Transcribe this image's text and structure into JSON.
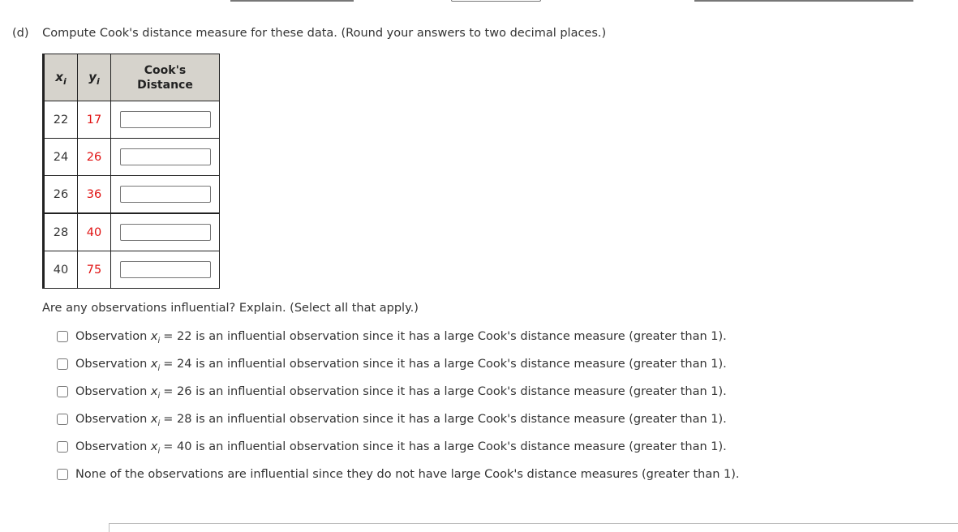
{
  "part": {
    "label": "(d)",
    "instruction": "Compute Cook's distance measure for these data. (Round your answers to two decimal places.)"
  },
  "table": {
    "headers": {
      "x": {
        "var": "x",
        "sub": "i"
      },
      "y": {
        "var": "y",
        "sub": "i"
      },
      "cooks_line1": "Cook's",
      "cooks_line2": "Distance"
    },
    "rows": [
      {
        "x": "22",
        "y": "17",
        "cooks_distance": ""
      },
      {
        "x": "24",
        "y": "26",
        "cooks_distance": ""
      },
      {
        "x": "26",
        "y": "36",
        "cooks_distance": ""
      },
      {
        "x": "28",
        "y": "40",
        "cooks_distance": ""
      },
      {
        "x": "40",
        "y": "75",
        "cooks_distance": ""
      }
    ]
  },
  "question": "Are any observations influential? Explain. (Select all that apply.)",
  "options": [
    {
      "prefix": "Observation",
      "var": "x",
      "sub": "i",
      "suffix": "= 22 is an influential observation since it has a large Cook's distance measure (greater than 1).",
      "checked": false
    },
    {
      "prefix": "Observation",
      "var": "x",
      "sub": "i",
      "suffix": "= 24 is an influential observation since it has a large Cook's distance measure (greater than 1).",
      "checked": false
    },
    {
      "prefix": "Observation",
      "var": "x",
      "sub": "i",
      "suffix": "= 26 is an influential observation since it has a large Cook's distance measure (greater than 1).",
      "checked": false
    },
    {
      "prefix": "Observation",
      "var": "x",
      "sub": "i",
      "suffix": "= 28 is an influential observation since it has a large Cook's distance measure (greater than 1).",
      "checked": false
    },
    {
      "prefix": "Observation",
      "var": "x",
      "sub": "i",
      "suffix": "= 40 is an influential observation since it has a large Cook's distance measure (greater than 1).",
      "checked": false
    },
    {
      "prefix": "None of the observations are influential since they do not have large Cook's distance measures (greater than 1).",
      "var": "",
      "sub": "",
      "suffix": "",
      "checked": false
    }
  ],
  "colors": {
    "y_values": "#e01010",
    "header_bg": "#d6d3cc"
  }
}
